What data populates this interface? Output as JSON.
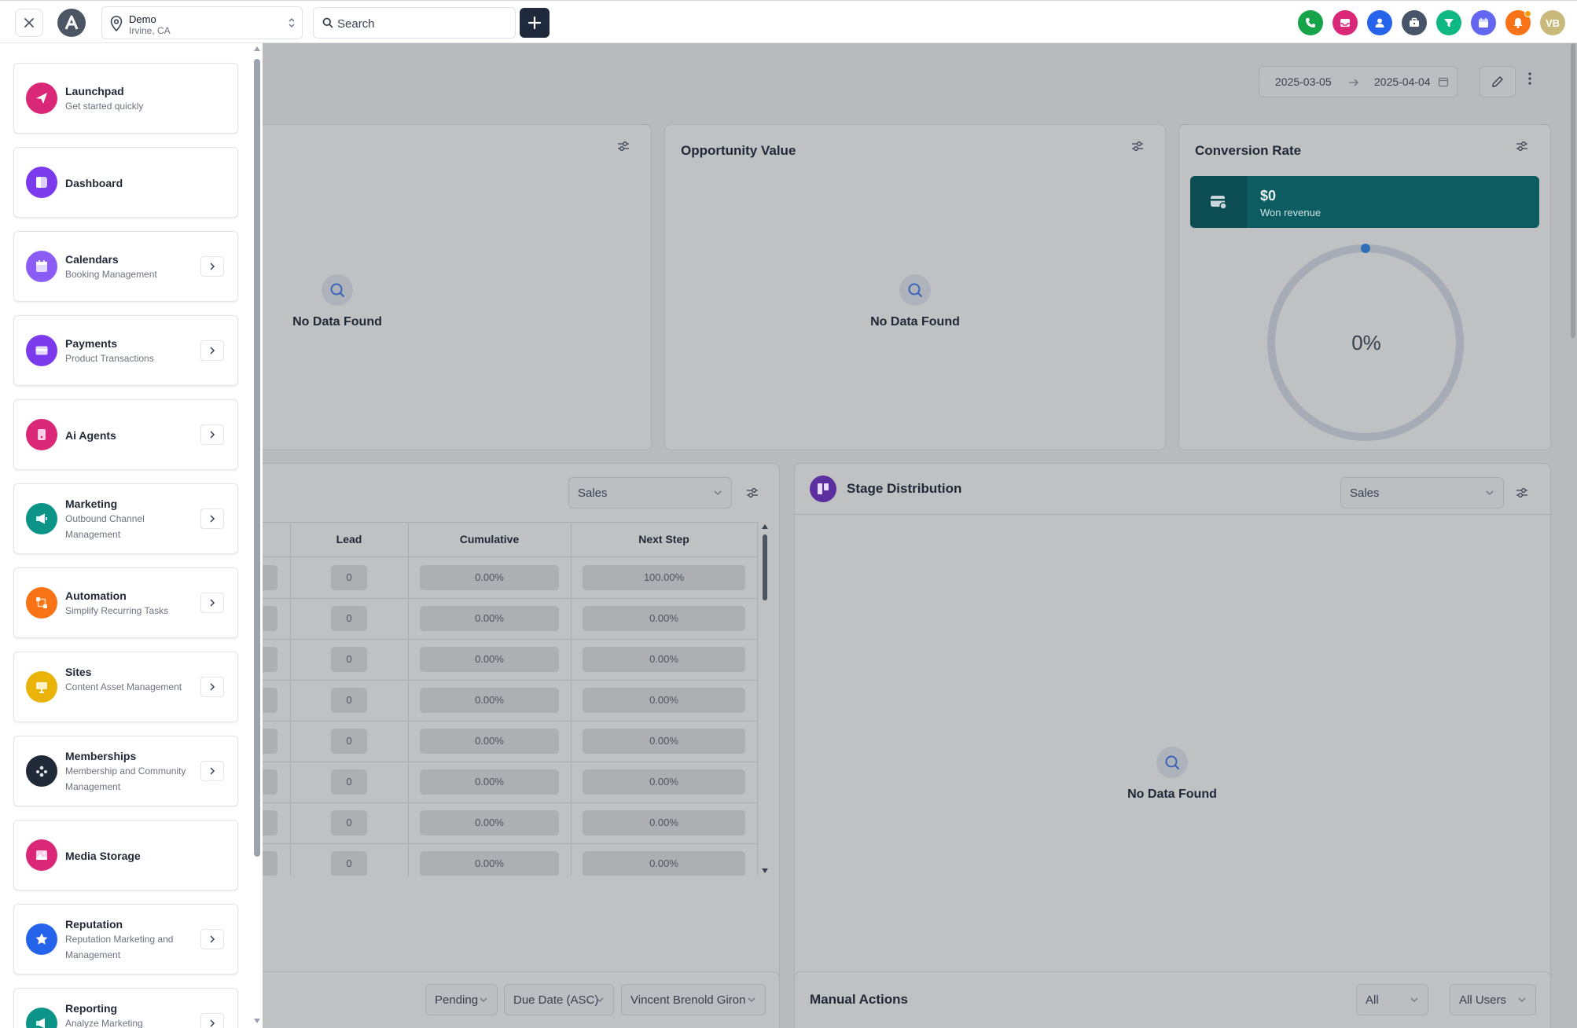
{
  "topbar": {
    "location_name": "Demo",
    "location_city": "Irvine, CA",
    "search_placeholder": "Search",
    "avatar_initials": "VB",
    "icons": [
      "phone-icon",
      "inbox-icon",
      "contacts-icon",
      "opportunities-icon",
      "funnel-icon",
      "calendar-icon",
      "notifications-icon"
    ],
    "colors": {
      "phone": "#16a34a",
      "inbox": "#db2777",
      "contacts": "#2563eb",
      "opportunities": "#475569",
      "funnel": "#10b981",
      "calendar": "#6366f1",
      "notifications": "#f97316",
      "avatar": "#c9b97a"
    }
  },
  "dashboard": {
    "date_from": "2025-03-05",
    "date_to": "2025-04-04",
    "card1": {
      "no_data": "No Data Found"
    },
    "opportunity_value": {
      "title": "Opportunity Value",
      "no_data": "No Data Found"
    },
    "conversion_rate": {
      "title": "Conversion Rate",
      "won_amount": "$0",
      "won_label": "Won revenue",
      "percent": "0%",
      "progress": 0
    },
    "funnel": {
      "select": "Sales",
      "columns": [
        "Lead",
        "Cumulative",
        "Next Step"
      ],
      "rows": [
        [
          "0",
          "0.00%",
          "100.00%"
        ],
        [
          "0",
          "0.00%",
          "0.00%"
        ],
        [
          "0",
          "0.00%",
          "0.00%"
        ],
        [
          "0",
          "0.00%",
          "0.00%"
        ],
        [
          "0",
          "0.00%",
          "0.00%"
        ],
        [
          "0",
          "0.00%",
          "0.00%"
        ],
        [
          "0",
          "0.00%",
          "0.00%"
        ],
        [
          "0",
          "0.00%",
          "0.00%"
        ]
      ]
    },
    "stage_distribution": {
      "title": "Stage Distribution",
      "select": "Sales",
      "no_data": "No Data Found"
    },
    "tasks": {
      "status": "Pending",
      "sort": "Due Date (ASC)",
      "user": "Vincent Brenold Giron"
    },
    "manual_actions": {
      "title": "Manual Actions",
      "filter1": "All",
      "filter2": "All Users"
    }
  },
  "sidebar": {
    "items": [
      {
        "title": "Launchpad",
        "subtitle": "Get started quickly",
        "icon": "launchpad-icon",
        "color": "#db2777",
        "arrow": false
      },
      {
        "title": "Dashboard",
        "subtitle": "",
        "icon": "dashboard-icon",
        "color": "#7c3aed",
        "arrow": false
      },
      {
        "title": "Calendars",
        "subtitle": "Booking Management",
        "icon": "calendar-icon",
        "color": "#8b5cf6",
        "arrow": true
      },
      {
        "title": "Payments",
        "subtitle": "Product Transactions",
        "icon": "payments-icon",
        "color": "#7c3aed",
        "arrow": true
      },
      {
        "title": "Ai Agents",
        "subtitle": "",
        "icon": "ai-agents-icon",
        "color": "#db2777",
        "arrow": true
      },
      {
        "title": "Marketing",
        "subtitle": "Outbound Channel Management",
        "icon": "marketing-icon",
        "color": "#0d9488",
        "arrow": true
      },
      {
        "title": "Automation",
        "subtitle": "Simplify Recurring Tasks",
        "icon": "automation-icon",
        "color": "#f97316",
        "arrow": true
      },
      {
        "title": "Sites",
        "subtitle": "Content Asset Management",
        "icon": "sites-icon",
        "color": "#eab308",
        "arrow": true
      },
      {
        "title": "Memberships",
        "subtitle": "Membership and Community Management",
        "icon": "memberships-icon",
        "color": "#1f2937",
        "arrow": true
      },
      {
        "title": "Media Storage",
        "subtitle": "",
        "icon": "media-storage-icon",
        "color": "#db2777",
        "arrow": false
      },
      {
        "title": "Reputation",
        "subtitle": "Reputation Marketing and Management",
        "icon": "reputation-icon",
        "color": "#2563eb",
        "arrow": true
      },
      {
        "title": "Reporting",
        "subtitle": "Analyze Marketing",
        "icon": "reporting-icon",
        "color": "#0d9488",
        "arrow": true
      }
    ]
  }
}
